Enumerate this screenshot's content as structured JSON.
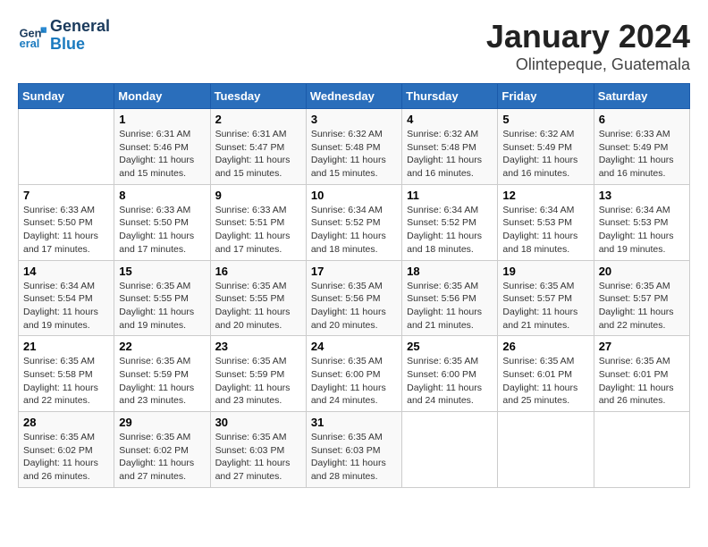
{
  "header": {
    "logo_line1": "General",
    "logo_line2": "Blue",
    "title": "January 2024",
    "subtitle": "Olintepeque, Guatemala"
  },
  "weekdays": [
    "Sunday",
    "Monday",
    "Tuesday",
    "Wednesday",
    "Thursday",
    "Friday",
    "Saturday"
  ],
  "weeks": [
    [
      {
        "day": "",
        "info": ""
      },
      {
        "day": "1",
        "info": "Sunrise: 6:31 AM\nSunset: 5:46 PM\nDaylight: 11 hours\nand 15 minutes."
      },
      {
        "day": "2",
        "info": "Sunrise: 6:31 AM\nSunset: 5:47 PM\nDaylight: 11 hours\nand 15 minutes."
      },
      {
        "day": "3",
        "info": "Sunrise: 6:32 AM\nSunset: 5:48 PM\nDaylight: 11 hours\nand 15 minutes."
      },
      {
        "day": "4",
        "info": "Sunrise: 6:32 AM\nSunset: 5:48 PM\nDaylight: 11 hours\nand 16 minutes."
      },
      {
        "day": "5",
        "info": "Sunrise: 6:32 AM\nSunset: 5:49 PM\nDaylight: 11 hours\nand 16 minutes."
      },
      {
        "day": "6",
        "info": "Sunrise: 6:33 AM\nSunset: 5:49 PM\nDaylight: 11 hours\nand 16 minutes."
      }
    ],
    [
      {
        "day": "7",
        "info": "Sunrise: 6:33 AM\nSunset: 5:50 PM\nDaylight: 11 hours\nand 17 minutes."
      },
      {
        "day": "8",
        "info": "Sunrise: 6:33 AM\nSunset: 5:50 PM\nDaylight: 11 hours\nand 17 minutes."
      },
      {
        "day": "9",
        "info": "Sunrise: 6:33 AM\nSunset: 5:51 PM\nDaylight: 11 hours\nand 17 minutes."
      },
      {
        "day": "10",
        "info": "Sunrise: 6:34 AM\nSunset: 5:52 PM\nDaylight: 11 hours\nand 18 minutes."
      },
      {
        "day": "11",
        "info": "Sunrise: 6:34 AM\nSunset: 5:52 PM\nDaylight: 11 hours\nand 18 minutes."
      },
      {
        "day": "12",
        "info": "Sunrise: 6:34 AM\nSunset: 5:53 PM\nDaylight: 11 hours\nand 18 minutes."
      },
      {
        "day": "13",
        "info": "Sunrise: 6:34 AM\nSunset: 5:53 PM\nDaylight: 11 hours\nand 19 minutes."
      }
    ],
    [
      {
        "day": "14",
        "info": "Sunrise: 6:34 AM\nSunset: 5:54 PM\nDaylight: 11 hours\nand 19 minutes."
      },
      {
        "day": "15",
        "info": "Sunrise: 6:35 AM\nSunset: 5:55 PM\nDaylight: 11 hours\nand 19 minutes."
      },
      {
        "day": "16",
        "info": "Sunrise: 6:35 AM\nSunset: 5:55 PM\nDaylight: 11 hours\nand 20 minutes."
      },
      {
        "day": "17",
        "info": "Sunrise: 6:35 AM\nSunset: 5:56 PM\nDaylight: 11 hours\nand 20 minutes."
      },
      {
        "day": "18",
        "info": "Sunrise: 6:35 AM\nSunset: 5:56 PM\nDaylight: 11 hours\nand 21 minutes."
      },
      {
        "day": "19",
        "info": "Sunrise: 6:35 AM\nSunset: 5:57 PM\nDaylight: 11 hours\nand 21 minutes."
      },
      {
        "day": "20",
        "info": "Sunrise: 6:35 AM\nSunset: 5:57 PM\nDaylight: 11 hours\nand 22 minutes."
      }
    ],
    [
      {
        "day": "21",
        "info": "Sunrise: 6:35 AM\nSunset: 5:58 PM\nDaylight: 11 hours\nand 22 minutes."
      },
      {
        "day": "22",
        "info": "Sunrise: 6:35 AM\nSunset: 5:59 PM\nDaylight: 11 hours\nand 23 minutes."
      },
      {
        "day": "23",
        "info": "Sunrise: 6:35 AM\nSunset: 5:59 PM\nDaylight: 11 hours\nand 23 minutes."
      },
      {
        "day": "24",
        "info": "Sunrise: 6:35 AM\nSunset: 6:00 PM\nDaylight: 11 hours\nand 24 minutes."
      },
      {
        "day": "25",
        "info": "Sunrise: 6:35 AM\nSunset: 6:00 PM\nDaylight: 11 hours\nand 24 minutes."
      },
      {
        "day": "26",
        "info": "Sunrise: 6:35 AM\nSunset: 6:01 PM\nDaylight: 11 hours\nand 25 minutes."
      },
      {
        "day": "27",
        "info": "Sunrise: 6:35 AM\nSunset: 6:01 PM\nDaylight: 11 hours\nand 26 minutes."
      }
    ],
    [
      {
        "day": "28",
        "info": "Sunrise: 6:35 AM\nSunset: 6:02 PM\nDaylight: 11 hours\nand 26 minutes."
      },
      {
        "day": "29",
        "info": "Sunrise: 6:35 AM\nSunset: 6:02 PM\nDaylight: 11 hours\nand 27 minutes."
      },
      {
        "day": "30",
        "info": "Sunrise: 6:35 AM\nSunset: 6:03 PM\nDaylight: 11 hours\nand 27 minutes."
      },
      {
        "day": "31",
        "info": "Sunrise: 6:35 AM\nSunset: 6:03 PM\nDaylight: 11 hours\nand 28 minutes."
      },
      {
        "day": "",
        "info": ""
      },
      {
        "day": "",
        "info": ""
      },
      {
        "day": "",
        "info": ""
      }
    ]
  ]
}
